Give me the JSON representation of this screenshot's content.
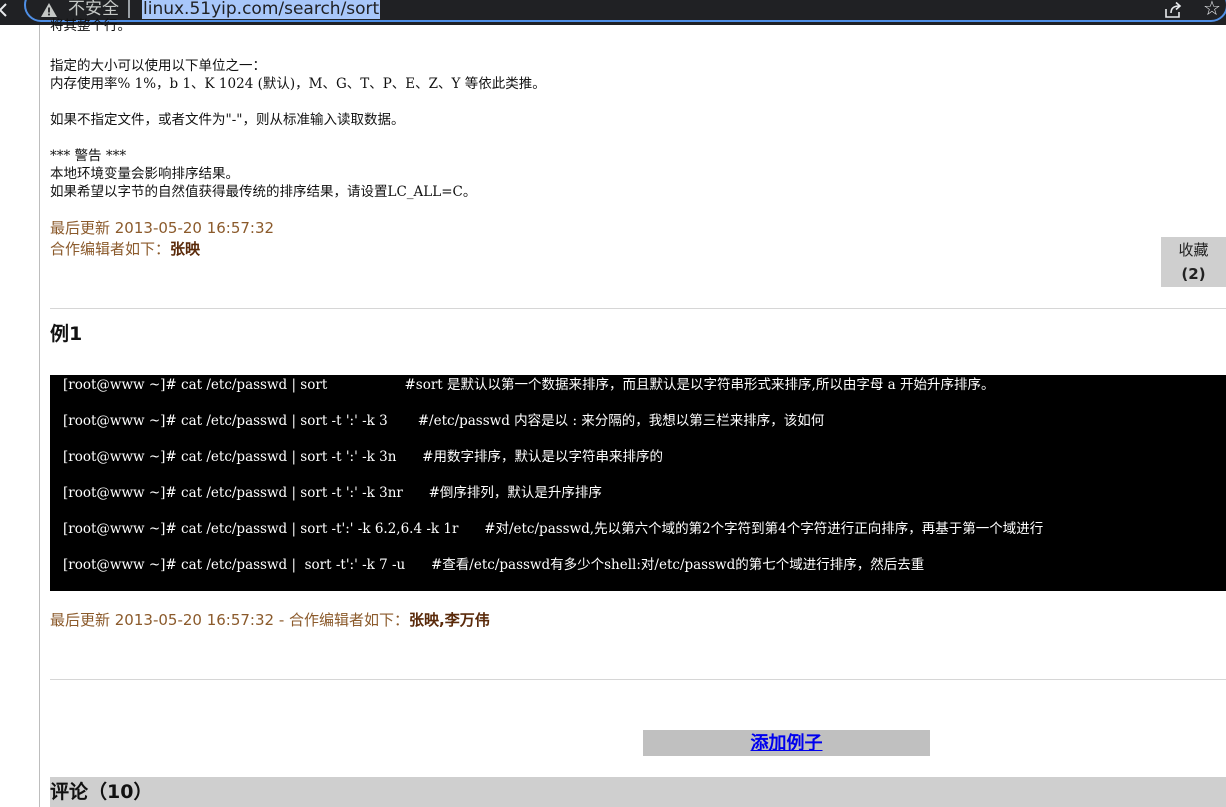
{
  "browser": {
    "security_label": "不安全",
    "url": "linux.51yip.com/search/sort",
    "back_icon": "back-chevron-icon",
    "warning_icon": "warning-triangle-icon",
    "share_icon": "share-icon",
    "star_icon": "bookmark-star-icon"
  },
  "doc_text": {
    "clipped_line": "将其整个行。",
    "units_1": "指定的大小可以使用以下单位之一：",
    "units_2": "内存使用率% 1%，b 1、K 1024 (默认)，M、G、T、P、E、Z、Y 等依此类推。",
    "stdin": "如果不指定文件，或者文件为\"-\"，则从标准输入读取数据。",
    "warning_title": "*** 警告 ***",
    "warning_1": "本地环境变量会影响排序结果。",
    "warning_2": "如果希望以字节的自然值获得最传统的排序结果，请设置LC_ALL=C。"
  },
  "meta_top": {
    "updated": "最后更新 2013-05-20 16:57:32",
    "editors_label": "合作编辑者如下：",
    "editors": "张映"
  },
  "favorite": {
    "label": "收藏",
    "count": "(2)"
  },
  "example": {
    "title": "例1",
    "code_lines": [
      "[root@www ~]# cat /etc/passwd | sort                  #sort 是默认以第一个数据来排序，而且默认是以字符串形式来排序,所以由字母 a 开始升序排序。",
      "[root@www ~]# cat /etc/passwd | sort -t ':' -k 3       #/etc/passwd 内容是以 : 来分隔的，我想以第三栏来排序，该如何",
      "[root@www ~]# cat /etc/passwd | sort -t ':' -k 3n      #用数字排序，默认是以字符串来排序的",
      "[root@www ~]# cat /etc/passwd | sort -t ':' -k 3nr      #倒序排列，默认是升序排序",
      "[root@www ~]# cat /etc/passwd | sort -t':' -k 6.2,6.4 -k 1r      #对/etc/passwd,先以第六个域的第2个字符到第4个字符进行正向排序，再基于第一个域进行",
      "[root@www ~]# cat /etc/passwd |  sort -t':' -k 7 -u      #查看/etc/passwd有多少个shell:对/etc/passwd的第七个域进行排序，然后去重"
    ],
    "meta_updated": "最后更新 2013-05-20 16:57:32 - 合作编辑者如下：",
    "meta_editors": "张映,李万伟"
  },
  "add_example_label": "添加例子",
  "comments": {
    "label": "评论（10）"
  }
}
